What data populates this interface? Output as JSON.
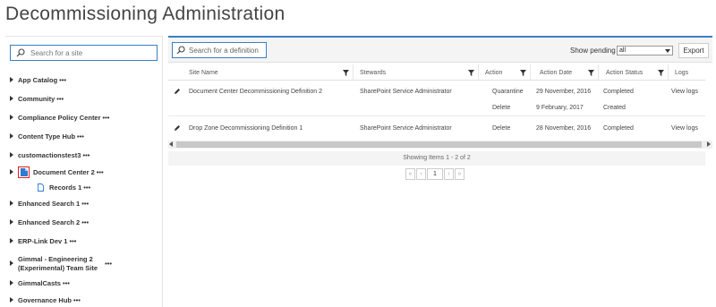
{
  "page": {
    "title": "Decommissioning Administration"
  },
  "sidebar": {
    "search_placeholder": "Search for a site",
    "items": [
      {
        "label": "App Catalog",
        "dots": "•••"
      },
      {
        "label": "Community",
        "dots": "•••"
      },
      {
        "label": "Compliance Policy Center",
        "dots": "•••"
      },
      {
        "label": "Content Type Hub",
        "dots": "•••"
      },
      {
        "label": "customactionstest3",
        "dots": "•••"
      },
      {
        "label": "Document Center 2",
        "dots": "•••"
      },
      {
        "label": "Records 1",
        "dots": "•••"
      },
      {
        "label": "Enhanced Search 1",
        "dots": "•••"
      },
      {
        "label": "Enhanced Search 2",
        "dots": "•••"
      },
      {
        "label": "ERP-Link Dev 1",
        "dots": "•••"
      },
      {
        "label_line1": "Gimmal - Engineering 2",
        "label_line2": "(Experimental) Team Site",
        "dots": "•••"
      },
      {
        "label": "GimmalCasts",
        "dots": "•••"
      },
      {
        "label": "Governance Hub",
        "dots": "•••"
      }
    ]
  },
  "toolbar": {
    "search_placeholder": "Search for a definition",
    "pending_label": "Show pending",
    "pending_value": "all",
    "export_label": "Export"
  },
  "grid": {
    "columns": [
      "Site Name",
      "Stewards",
      "Action",
      "Action Date",
      "Action Status",
      "Logs"
    ],
    "rows": [
      {
        "site_name": "Document Center Decommissioning Definition 2",
        "stewards": "SharePoint Service Administrator",
        "actions": [
          "Quarantine",
          "Delete"
        ],
        "dates": [
          "29 November, 2016",
          "9 February, 2017"
        ],
        "statuses": [
          "Completed",
          "Created"
        ],
        "logs": "View logs"
      },
      {
        "site_name": "Drop Zone Decommissioning Definition 1",
        "stewards": "SharePoint Service Administrator",
        "actions": [
          "Delete"
        ],
        "dates": [
          "28 November, 2016"
        ],
        "statuses": [
          "Completed"
        ],
        "logs": "View logs"
      }
    ],
    "showing_text": "Showing Items 1 - 2 of 2"
  },
  "pager": {
    "first": "«",
    "prev": "‹",
    "current": "1",
    "next": "›",
    "last": "»"
  },
  "colors": {
    "accent": "#3a7fc5",
    "highlight_box": "#e02020",
    "doc_icon": "#2b7cd3"
  }
}
